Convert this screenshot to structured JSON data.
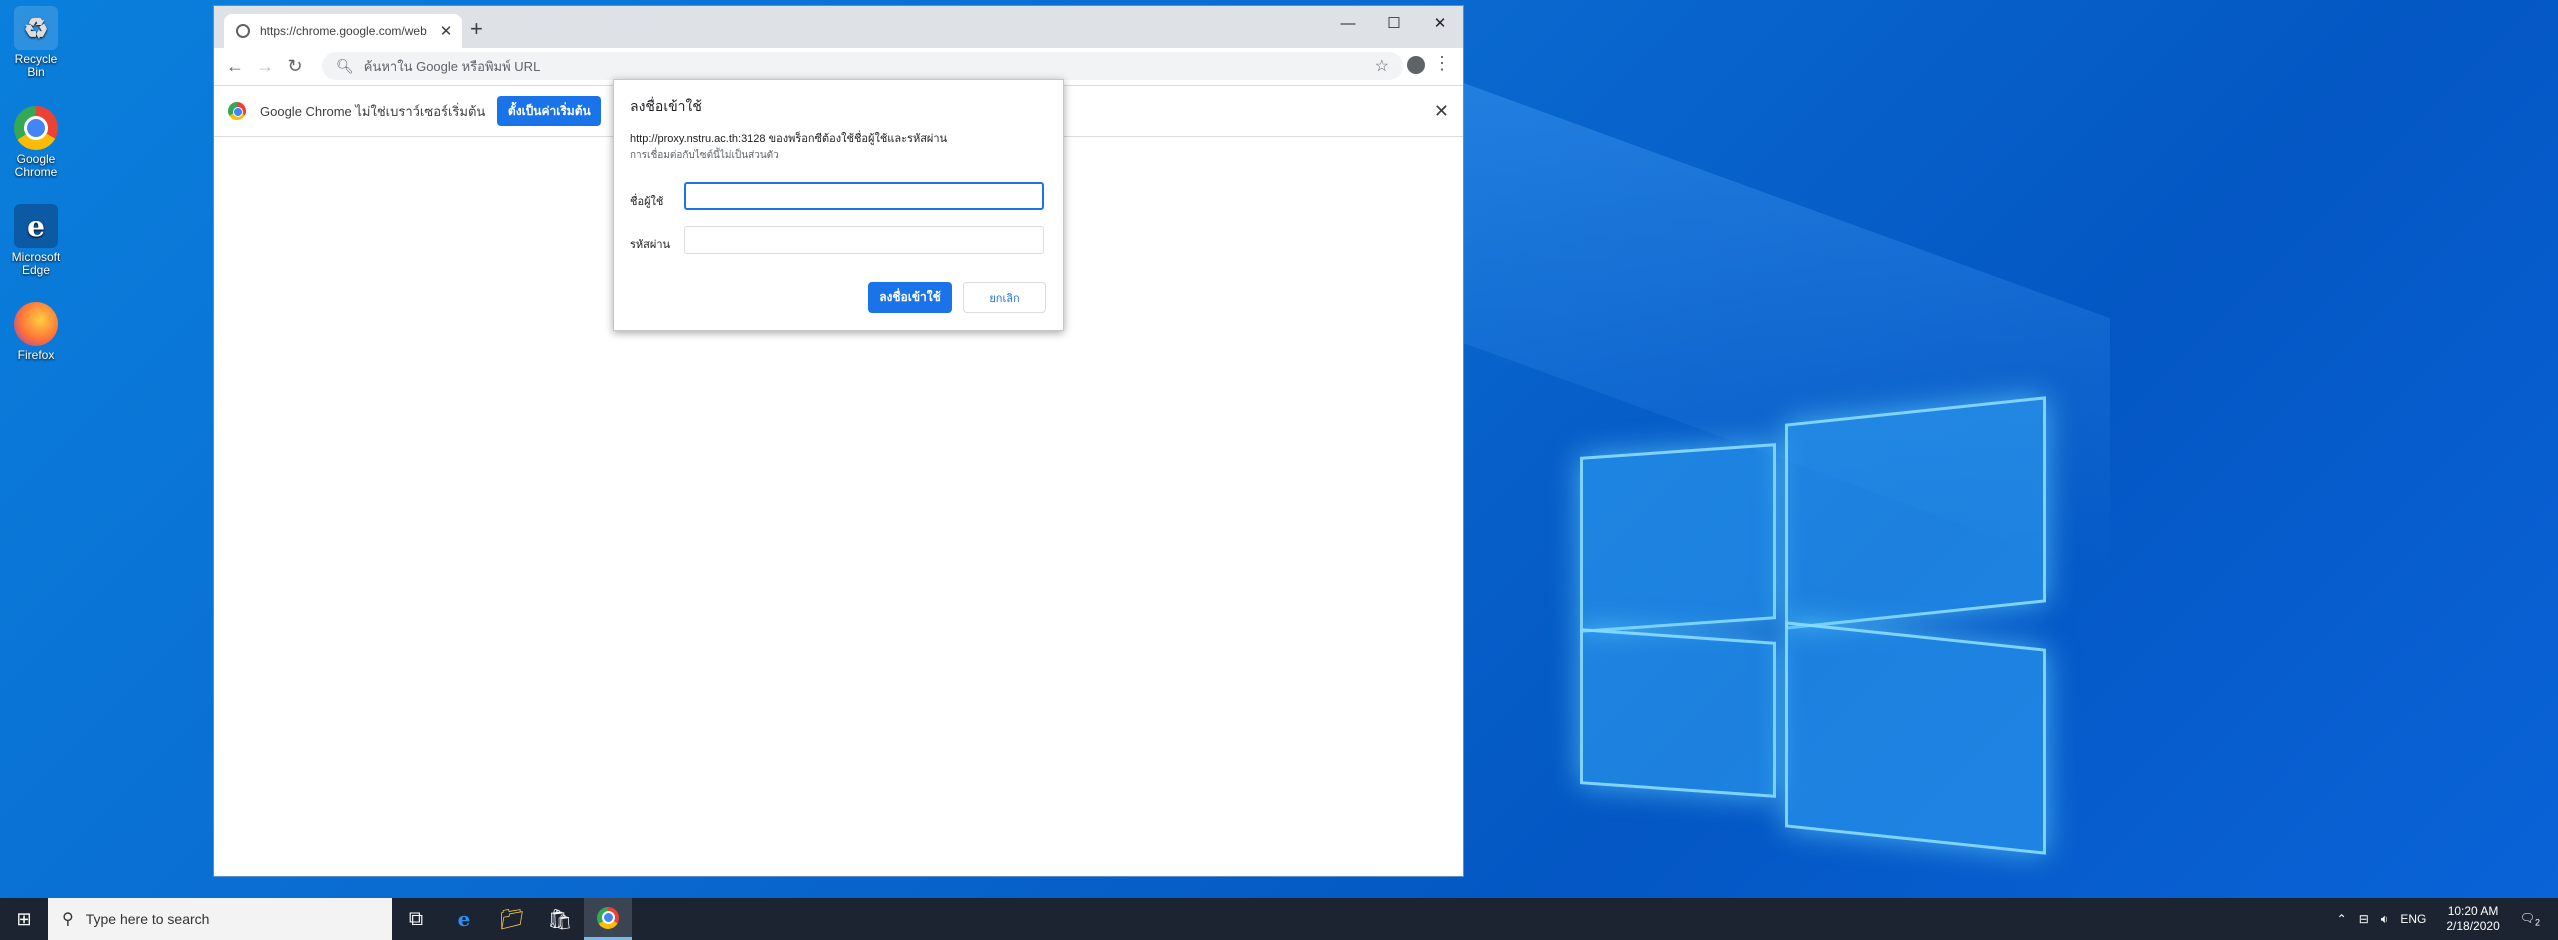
{
  "desktop": {
    "icons": [
      {
        "label": "Recycle Bin"
      },
      {
        "label": "Google Chrome"
      },
      {
        "label": "Microsoft Edge"
      },
      {
        "label": "Firefox"
      }
    ]
  },
  "browser": {
    "tab_title": "https://chrome.google.com/web",
    "tab_close": "✕",
    "new_tab": "+",
    "omnibox_placeholder": "ค้นหาใน Google หรือพิมพ์ URL",
    "infobar_text": "Google Chrome ไม่ใช่เบราว์เซอร์เริ่มต้น",
    "infobar_button": "ตั้งเป็นค่าเริ่มต้น",
    "infobar_close": "✕"
  },
  "dialog": {
    "title": "ลงชื่อเข้าใช้",
    "line1": "http://proxy.nstru.ac.th:3128 ของพร็อกซีต้องใช้ชื่อผู้ใช้และรหัสผ่าน",
    "line2": "การเชื่อมต่อกับไซต์นี้ไม่เป็นส่วนตัว",
    "username_label": "ชื่อผู้ใช้",
    "password_label": "รหัสผ่าน",
    "username_value": "",
    "password_value": "",
    "ok_button": "ลงชื่อเข้าใช้",
    "cancel_button": "ยกเลิก"
  },
  "taskbar": {
    "search_placeholder": "Type here to search",
    "language": "ENG",
    "time": "10:20 AM",
    "date": "2/18/2020",
    "notification_count": "2"
  },
  "colors": {
    "accent": "#1a73e8",
    "taskbar": "#1b2430"
  }
}
